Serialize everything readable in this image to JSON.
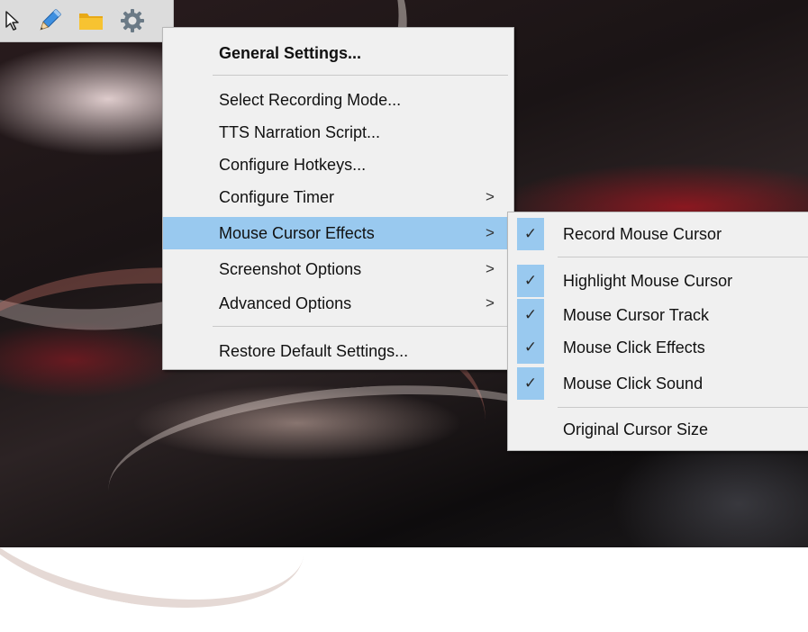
{
  "toolbar": {
    "items": [
      {
        "icon": "cursor-arrow-icon"
      },
      {
        "icon": "pencil-icon"
      },
      {
        "icon": "folder-icon"
      },
      {
        "icon": "gear-icon"
      }
    ]
  },
  "main_menu": {
    "general_settings": "General Settings...",
    "select_recording_mode": "Select Recording Mode...",
    "tts_narration_script": "TTS Narration Script...",
    "configure_hotkeys": "Configure Hotkeys...",
    "configure_timer": "Configure Timer",
    "mouse_cursor_effects": "Mouse Cursor Effects",
    "screenshot_options": "Screenshot Options",
    "advanced_options": "Advanced Options",
    "restore_default_settings": "Restore Default Settings...",
    "submenu_arrow": ">"
  },
  "sub_menu": {
    "check_glyph": "✓",
    "items": [
      {
        "label": "Record Mouse Cursor",
        "checked": true
      },
      {
        "label": "Highlight Mouse Cursor",
        "checked": true
      },
      {
        "label": "Mouse Cursor Track",
        "checked": true
      },
      {
        "label": "Mouse Click Effects",
        "checked": true
      },
      {
        "label": "Mouse Click Sound",
        "checked": true
      },
      {
        "label": "Original Cursor Size",
        "checked": false
      }
    ]
  },
  "colors": {
    "menu_bg": "#f0f0f0",
    "highlight": "#99c9ef",
    "separator": "#c9c9c9",
    "toolbar_bg": "#dcdcdc"
  }
}
